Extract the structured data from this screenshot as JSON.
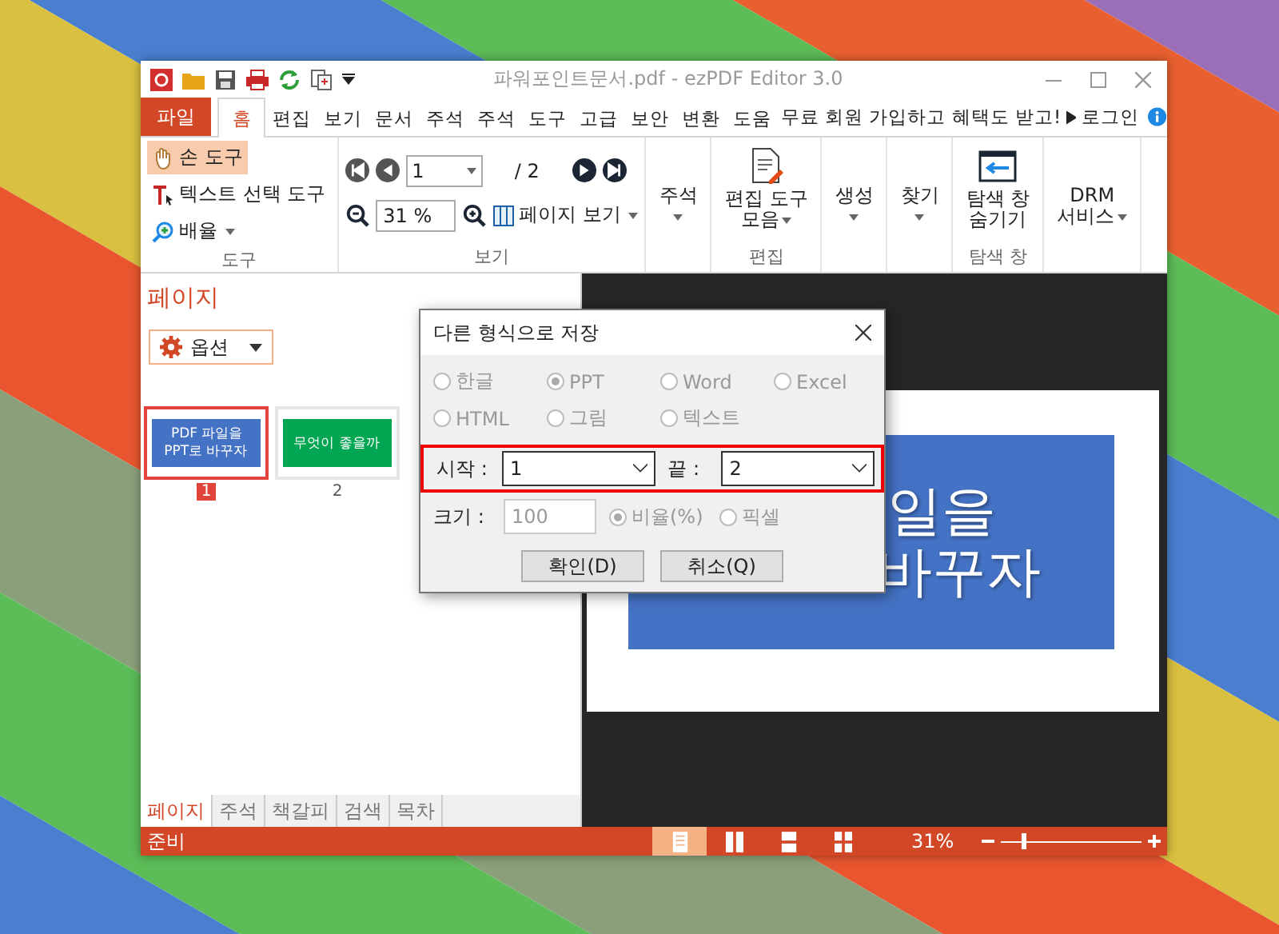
{
  "window": {
    "title": "파워포인트문서.pdf - ezPDF Editor 3.0"
  },
  "menu": {
    "file": "파일",
    "tabs": [
      {
        "label": "홈",
        "selected": true
      },
      {
        "label": "편집",
        "selected": false
      },
      {
        "label": "보기",
        "selected": false
      },
      {
        "label": "문서",
        "selected": false
      },
      {
        "label": "주석",
        "selected": false
      },
      {
        "label": "주석",
        "selected": false
      },
      {
        "label": "도구",
        "selected": false
      },
      {
        "label": "고급",
        "selected": false
      },
      {
        "label": "보안",
        "selected": false
      },
      {
        "label": "변환",
        "selected": false
      },
      {
        "label": "도움",
        "selected": false
      }
    ],
    "promo": "무료 회원 가입하고 혜택도 받고!",
    "login": "로그인"
  },
  "ribbon": {
    "tool_group": {
      "label": "도구",
      "items": [
        {
          "kind": "hand",
          "label": "손 도구",
          "selected": true,
          "dropdown": false
        },
        {
          "kind": "text",
          "label": "텍스트 선택 도구",
          "selected": false,
          "dropdown": false
        },
        {
          "kind": "zoom",
          "label": "배율",
          "selected": false,
          "dropdown": true
        }
      ]
    },
    "view_group": {
      "label": "보기",
      "page": "1",
      "total": "/ 2",
      "zoom": "31 %",
      "page_view": "페이지 보기"
    },
    "groups": [
      {
        "buttons": [
          {
            "kind": "plain",
            "lines": [
              "주석"
            ],
            "dropdown": true
          }
        ]
      },
      {
        "label": "편집",
        "buttons": [
          {
            "kind": "edit",
            "lines": [
              "편집 도구",
              "모음"
            ],
            "dropdown": true
          }
        ]
      },
      {
        "buttons": [
          {
            "kind": "plain",
            "lines": [
              "생성"
            ],
            "dropdown": true
          }
        ]
      },
      {
        "buttons": [
          {
            "kind": "plain",
            "lines": [
              "찾기"
            ],
            "dropdown": true
          }
        ]
      },
      {
        "label": "탐색 창",
        "buttons": [
          {
            "kind": "panel",
            "lines": [
              "탐색 창",
              "숨기기"
            ],
            "dropdown": false
          }
        ]
      },
      {
        "buttons": [
          {
            "kind": "plain",
            "lines": [
              "DRM",
              "서비스"
            ],
            "dropdown": true
          }
        ]
      }
    ]
  },
  "left_panel": {
    "title": "페이지",
    "options": "옵션",
    "thumbnails": [
      {
        "number": "1",
        "selected": true,
        "color": "#4472c4",
        "lines": [
          "PDF 파일을",
          "PPT로 바꾸자"
        ]
      },
      {
        "number": "2",
        "selected": false,
        "color": "#00a651",
        "lines": [
          "무엇이 좋을까"
        ]
      }
    ],
    "tabs": [
      {
        "label": "페이지",
        "selected": true
      },
      {
        "label": "주석",
        "selected": false
      },
      {
        "label": "책갈피",
        "selected": false
      },
      {
        "label": "검색",
        "selected": false
      },
      {
        "label": "목차",
        "selected": false
      }
    ]
  },
  "viewer": {
    "slide_lines": [
      "일을",
      "바꾸자"
    ]
  },
  "dialog": {
    "title": "다른 형식으로 저장",
    "formats_disabled": true,
    "formats": [
      {
        "label": "한글",
        "selected": false
      },
      {
        "label": "PPT",
        "selected": true
      },
      {
        "label": "Word",
        "selected": false
      },
      {
        "label": "Excel",
        "selected": false
      },
      {
        "label": "HTML",
        "selected": false
      },
      {
        "label": "그림",
        "selected": false
      },
      {
        "label": "텍스트",
        "selected": false
      }
    ],
    "start_label": "시작 :",
    "start": "1",
    "end_label": "끝 :",
    "end": "2",
    "size_label": "크기 :",
    "size": "100",
    "size_disabled": true,
    "size_modes": [
      {
        "label": "비율(%)",
        "selected": true
      },
      {
        "label": "픽셀",
        "selected": false
      }
    ],
    "buttons": [
      "확인(D)",
      "취소(Q)"
    ]
  },
  "status_bar": {
    "text": "준비",
    "views": [
      {
        "kind": "single",
        "selected": true
      },
      {
        "kind": "double",
        "selected": false
      },
      {
        "kind": "scroll",
        "selected": false
      },
      {
        "kind": "grid",
        "selected": false
      }
    ],
    "zoom": "31%",
    "zoom_slider": {
      "level": 0.15
    }
  }
}
